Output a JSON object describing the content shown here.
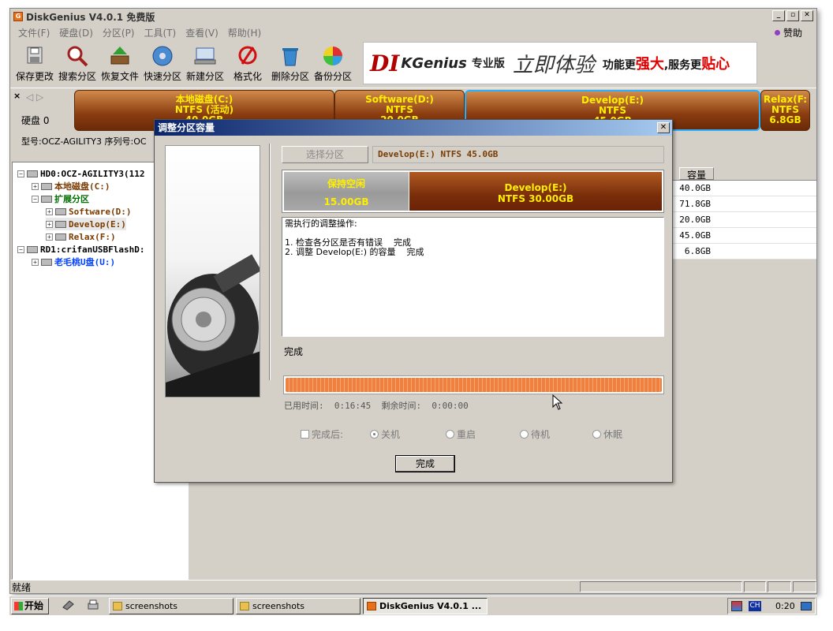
{
  "window": {
    "title": "DiskGenius V4.0.1 免费版"
  },
  "menu": [
    "文件(F)",
    "硬盘(D)",
    "分区(P)",
    "工具(T)",
    "查看(V)",
    "帮助(H)"
  ],
  "donate_label": "赞助",
  "toolbar": [
    {
      "label": "保存更改",
      "icon": "save-icon"
    },
    {
      "label": "搜索分区",
      "icon": "search-icon"
    },
    {
      "label": "恢复文件",
      "icon": "recover-icon"
    },
    {
      "label": "快速分区",
      "icon": "quick-partition-icon"
    },
    {
      "label": "新建分区",
      "icon": "new-partition-icon"
    },
    {
      "label": "格式化",
      "icon": "format-icon"
    },
    {
      "label": "删除分区",
      "icon": "delete-icon"
    },
    {
      "label": "备份分区",
      "icon": "backup-icon"
    }
  ],
  "banner": {
    "brand_d": "DI",
    "brand_k": "KGenius",
    "edition": "专业版",
    "script": "立即体验",
    "slogan_a": "功能更",
    "slogan_b": "强大",
    "slogan_c": ",服务更",
    "slogan_d": "贴心"
  },
  "disk": {
    "label": "硬盘 0",
    "model": "型号:OCZ-AGILITY3   序列号:OC"
  },
  "partitions": [
    {
      "name": "本地磁盘(C:)",
      "fs": "NTFS (活动)",
      "size": "40.0GB",
      "selected": false
    },
    {
      "name": "Software(D:)",
      "fs": "NTFS",
      "size": "20.0GB",
      "selected": false
    },
    {
      "name": "Develop(E:)",
      "fs": "NTFS",
      "size": "45.0GB",
      "selected": true
    },
    {
      "name": "Relax(F:",
      "fs": "NTFS",
      "size": "6.8GB",
      "selected": false
    }
  ],
  "tree": [
    {
      "text": "HD0:OCZ-AGILITY3(112",
      "color": "#000000"
    },
    {
      "text": "本地磁盘(C:)",
      "color": "#7a3a00"
    },
    {
      "text": "扩展分区",
      "color": "#007000"
    },
    {
      "text": "Software(D:)",
      "color": "#7a3a00"
    },
    {
      "text": "Develop(E:)",
      "color": "#7a3a00"
    },
    {
      "text": "Relax(F:)",
      "color": "#7a3a00"
    },
    {
      "text": "RD1:crifanUSBFlashD:",
      "color": "#000000"
    },
    {
      "text": "老毛桃U盘(U:)",
      "color": "#0040ff"
    }
  ],
  "list": {
    "capacity_header": "容量",
    "capacities": [
      "40.0GB",
      "71.8GB",
      "20.0GB",
      "45.0GB",
      "6.8GB"
    ]
  },
  "status": "就绪",
  "dialog": {
    "title": "调整分区容量",
    "select_button": "选择分区",
    "selected_partition": "Develop(E:) NTFS 45.0GB",
    "free_label": "保持空闲",
    "free_size": "15.00GB",
    "new_part_name": "Develop(E:)",
    "new_part_info": "NTFS 30.00GB",
    "log_title": "需执行的调整操作:",
    "log_step1": "1. 检查各分区是否有错误    完成",
    "log_step2": "2. 调整 Develop(E:) 的容量    完成",
    "state": "完成",
    "progress": 1.0,
    "elapsed_label": "已用时间:",
    "elapsed": "0:16:45",
    "remaining_label": "剩余时间:",
    "remaining": "0:00:00",
    "after_label": "完成后:",
    "options": [
      "关机",
      "重启",
      "待机",
      "休眠"
    ],
    "finish_button": "完成"
  },
  "taskbar": {
    "start": "开始",
    "tasks": [
      "screenshots",
      "screenshots",
      "DiskGenius V4.0.1 ..."
    ],
    "lang": "CH",
    "clock": "0:20"
  }
}
